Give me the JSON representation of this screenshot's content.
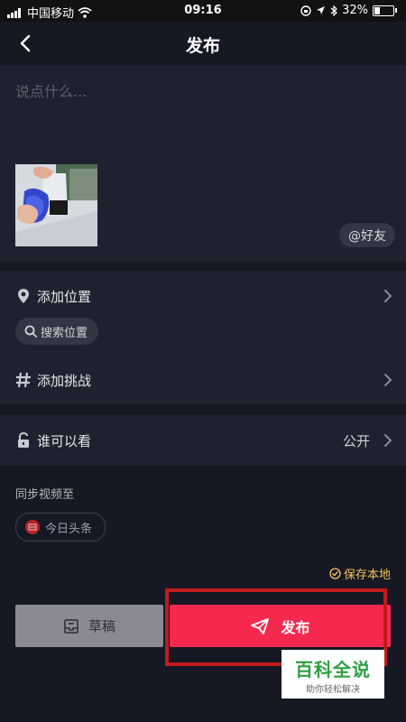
{
  "status_bar": {
    "carrier": "中国移动",
    "time": "09:16",
    "battery": "32%",
    "battery_level": 0.32
  },
  "nav": {
    "title": "发布"
  },
  "description": {
    "placeholder": "说点什么...",
    "at_friend_label": "@好友"
  },
  "options": {
    "add_location": "添加位置",
    "search_location": "搜索位置",
    "add_challenge": "添加挑战"
  },
  "privacy": {
    "label": "谁可以看",
    "value": "公开"
  },
  "sync": {
    "label": "同步视频至",
    "platform": "今日头条"
  },
  "save_local": "保存本地",
  "actions": {
    "draft_label": "草稿",
    "publish_label": "发布"
  },
  "watermark": {
    "main": "百科全说",
    "sub": "助你轻松解决"
  },
  "colors": {
    "background": "#161823",
    "section": "#1f2130",
    "publish": "#f5294e",
    "draft": "#898a92",
    "save_local": "#f5c15c",
    "highlight": "#c2191d"
  }
}
